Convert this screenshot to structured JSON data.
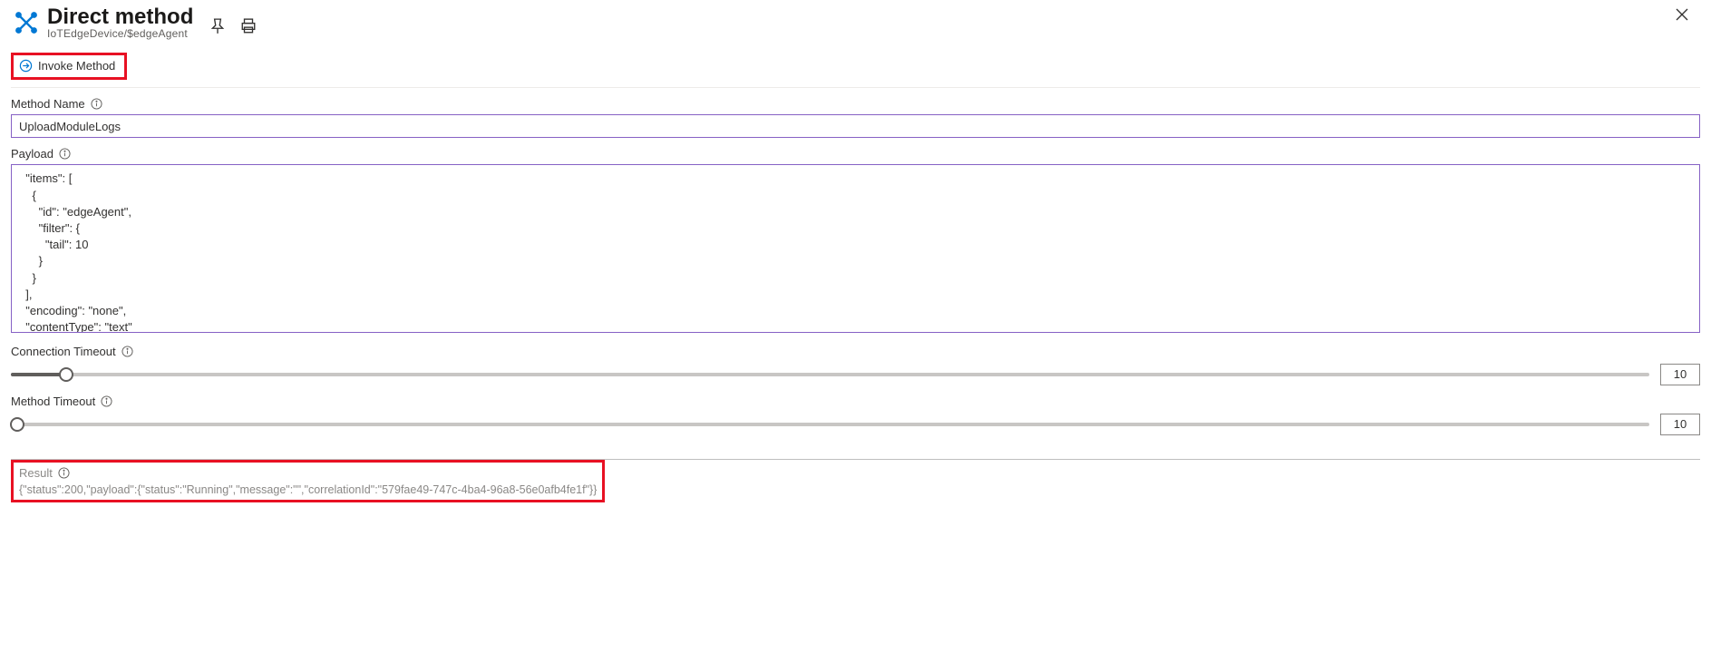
{
  "header": {
    "title": "Direct method",
    "subtitle": "IoTEdgeDevice/$edgeAgent"
  },
  "toolbar": {
    "invoke_label": "Invoke Method"
  },
  "fields": {
    "method_name_label": "Method Name",
    "method_name_value": "UploadModuleLogs",
    "payload_label": "Payload",
    "payload_value": "  \"items\": [\n    {\n      \"id\": \"edgeAgent\",\n      \"filter\": {\n        \"tail\": 10\n      }\n    }\n  ],\n  \"encoding\": \"none\",\n  \"contentType\": \"text\"",
    "connection_timeout_label": "Connection Timeout",
    "connection_timeout_value": "10",
    "method_timeout_label": "Method Timeout",
    "method_timeout_value": "10"
  },
  "result": {
    "label": "Result",
    "value": "{\"status\":200,\"payload\":{\"status\":\"Running\",\"message\":\"\",\"correlationId\":\"579fae49-747c-4ba4-96a8-56e0afb4fe1f\"}}"
  }
}
